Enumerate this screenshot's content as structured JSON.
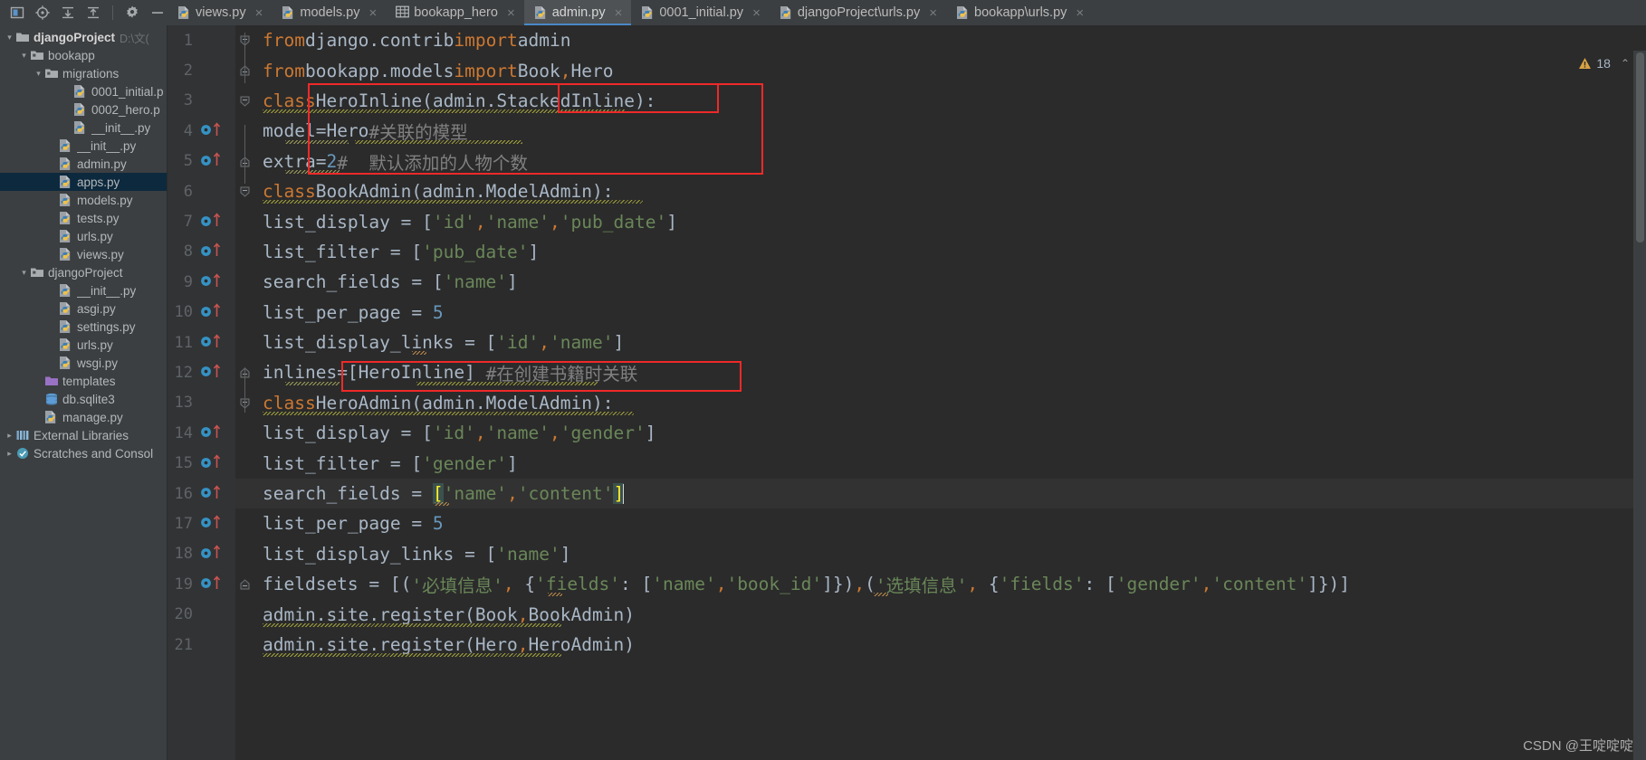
{
  "toolbar": {
    "icons": [
      {
        "name": "project-view-icon",
        "label": "Project"
      },
      {
        "name": "locate-target-icon",
        "label": "Select Opened File"
      },
      {
        "name": "expand-all-icon",
        "label": "Expand All"
      },
      {
        "name": "collapse-all-icon",
        "label": "Collapse All"
      },
      {
        "name": "gear-icon",
        "label": "Settings"
      },
      {
        "name": "minimize-icon",
        "label": "Hide"
      }
    ]
  },
  "tabs": [
    {
      "label": "views.py",
      "icon": "python-file-icon",
      "active": false
    },
    {
      "label": "models.py",
      "icon": "python-file-icon",
      "active": false
    },
    {
      "label": "bookapp_hero",
      "icon": "table-icon",
      "active": false
    },
    {
      "label": "admin.py",
      "icon": "python-file-icon",
      "active": true
    },
    {
      "label": "0001_initial.py",
      "icon": "python-file-icon",
      "active": false
    },
    {
      "label": "djangoProject\\urls.py",
      "icon": "python-file-icon",
      "active": false
    },
    {
      "label": "bookapp\\urls.py",
      "icon": "python-file-icon",
      "active": false
    }
  ],
  "tab_close_glyph": "×",
  "sidebar": {
    "items": [
      {
        "label": "djangoProject",
        "sub": "D:\\文(",
        "icon": "folder-icon",
        "indent": 0,
        "arrow": "expanded",
        "bold": true,
        "selected": false
      },
      {
        "label": "bookapp",
        "sub": "",
        "icon": "module-folder-icon",
        "indent": 1,
        "arrow": "expanded",
        "bold": false,
        "selected": false
      },
      {
        "label": "migrations",
        "sub": "",
        "icon": "module-folder-icon",
        "indent": 2,
        "arrow": "expanded",
        "bold": false,
        "selected": false
      },
      {
        "label": "0001_initial.p",
        "sub": "",
        "icon": "python-file-icon",
        "indent": 4,
        "arrow": "none",
        "bold": false,
        "selected": false
      },
      {
        "label": "0002_hero.p",
        "sub": "",
        "icon": "python-file-icon",
        "indent": 4,
        "arrow": "none",
        "bold": false,
        "selected": false
      },
      {
        "label": "__init__.py",
        "sub": "",
        "icon": "python-file-icon",
        "indent": 4,
        "arrow": "none",
        "bold": false,
        "selected": false
      },
      {
        "label": "__init__.py",
        "sub": "",
        "icon": "python-file-icon",
        "indent": 3,
        "arrow": "none",
        "bold": false,
        "selected": false
      },
      {
        "label": "admin.py",
        "sub": "",
        "icon": "python-file-icon",
        "indent": 3,
        "arrow": "none",
        "bold": false,
        "selected": false
      },
      {
        "label": "apps.py",
        "sub": "",
        "icon": "python-file-icon",
        "indent": 3,
        "arrow": "none",
        "bold": false,
        "selected": true
      },
      {
        "label": "models.py",
        "sub": "",
        "icon": "python-file-icon",
        "indent": 3,
        "arrow": "none",
        "bold": false,
        "selected": false
      },
      {
        "label": "tests.py",
        "sub": "",
        "icon": "python-file-icon",
        "indent": 3,
        "arrow": "none",
        "bold": false,
        "selected": false
      },
      {
        "label": "urls.py",
        "sub": "",
        "icon": "python-file-icon",
        "indent": 3,
        "arrow": "none",
        "bold": false,
        "selected": false
      },
      {
        "label": "views.py",
        "sub": "",
        "icon": "python-file-icon",
        "indent": 3,
        "arrow": "none",
        "bold": false,
        "selected": false
      },
      {
        "label": "djangoProject",
        "sub": "",
        "icon": "module-folder-icon",
        "indent": 1,
        "arrow": "expanded",
        "bold": false,
        "selected": false
      },
      {
        "label": "__init__.py",
        "sub": "",
        "icon": "python-file-icon",
        "indent": 3,
        "arrow": "none",
        "bold": false,
        "selected": false
      },
      {
        "label": "asgi.py",
        "sub": "",
        "icon": "python-file-icon",
        "indent": 3,
        "arrow": "none",
        "bold": false,
        "selected": false
      },
      {
        "label": "settings.py",
        "sub": "",
        "icon": "python-file-icon",
        "indent": 3,
        "arrow": "none",
        "bold": false,
        "selected": false
      },
      {
        "label": "urls.py",
        "sub": "",
        "icon": "python-file-icon",
        "indent": 3,
        "arrow": "none",
        "bold": false,
        "selected": false
      },
      {
        "label": "wsgi.py",
        "sub": "",
        "icon": "python-file-icon",
        "indent": 3,
        "arrow": "none",
        "bold": false,
        "selected": false
      },
      {
        "label": "templates",
        "sub": "",
        "icon": "templates-folder-icon",
        "indent": 2,
        "arrow": "none",
        "bold": false,
        "selected": false
      },
      {
        "label": "db.sqlite3",
        "sub": "",
        "icon": "database-icon",
        "indent": 2,
        "arrow": "none",
        "bold": false,
        "selected": false
      },
      {
        "label": "manage.py",
        "sub": "",
        "icon": "python-file-icon",
        "indent": 2,
        "arrow": "none",
        "bold": false,
        "selected": false
      },
      {
        "label": "External Libraries",
        "sub": "",
        "icon": "library-icon",
        "indent": 0,
        "arrow": "collapsed",
        "bold": false,
        "selected": false
      },
      {
        "label": "Scratches and Consol",
        "sub": "",
        "icon": "scratches-icon",
        "indent": 0,
        "arrow": "collapsed",
        "bold": false,
        "selected": false
      }
    ]
  },
  "editor": {
    "file": "admin.py",
    "warning_count": "18",
    "warning_icon": "warning-triangle-icon",
    "chevron_up_glyph": "⌃",
    "line_numbers": [
      "1",
      "2",
      "3",
      "4",
      "5",
      "6",
      "7",
      "8",
      "9",
      "10",
      "11",
      "12",
      "13",
      "14",
      "15",
      "16",
      "17",
      "18",
      "19",
      "20",
      "21"
    ],
    "lines": [
      {
        "n": 1,
        "text": "from django.contrib import admin"
      },
      {
        "n": 2,
        "text": "from bookapp.models import Book, Hero"
      },
      {
        "n": 3,
        "text": "class HeroInline(admin.StackedInline):"
      },
      {
        "n": 4,
        "text": "    model=Hero #关联的模型"
      },
      {
        "n": 5,
        "text": "    extra=2 #  默认添加的人物个数"
      },
      {
        "n": 6,
        "text": "class BookAdmin(admin.ModelAdmin):"
      },
      {
        "n": 7,
        "text": "    list_display = ['id', 'name', 'pub_date']"
      },
      {
        "n": 8,
        "text": "    list_filter = ['pub_date']"
      },
      {
        "n": 9,
        "text": "    search_fields = ['name']"
      },
      {
        "n": 10,
        "text": "    list_per_page = 5"
      },
      {
        "n": 11,
        "text": "    list_display_links = ['id','name']"
      },
      {
        "n": 12,
        "text": "    inlines=[HeroInline] #在创建书籍时关联"
      },
      {
        "n": 13,
        "text": "class HeroAdmin(admin.ModelAdmin):"
      },
      {
        "n": 14,
        "text": "    list_display = ['id', 'name', 'gender']"
      },
      {
        "n": 15,
        "text": "    list_filter = ['gender']"
      },
      {
        "n": 16,
        "text": "    search_fields = ['name','content']"
      },
      {
        "n": 17,
        "text": "    list_per_page = 5"
      },
      {
        "n": 18,
        "text": "    list_display_links = ['name']"
      },
      {
        "n": 19,
        "text": "    fieldsets = [('必填信息', {'fields': ['name','book_id']}),('选填信息', {'fields': ['gender','content']})]"
      },
      {
        "n": 20,
        "text": "admin.site.register(Book, BookAdmin)"
      },
      {
        "n": 21,
        "text": "admin.site.register(Hero,HeroAdmin)"
      }
    ]
  },
  "annotations": {
    "boxes": [
      {
        "name": "stackedinline-highlight-box"
      },
      {
        "name": "heroinline-class-box"
      },
      {
        "name": "inlines-line-box"
      }
    ]
  },
  "watermark": {
    "text": "CSDN @王啶啶啶"
  },
  "colors": {
    "accent_blue": "#4a88c7",
    "keyword_orange": "#cc7832",
    "string_green": "#6a8759",
    "number_blue": "#6897bb",
    "comment_gray": "#808080",
    "annotation_red": "#ef2929",
    "selection_navy": "#0d293e",
    "editor_bg": "#2b2b2b",
    "panel_bg": "#3c3f41"
  }
}
